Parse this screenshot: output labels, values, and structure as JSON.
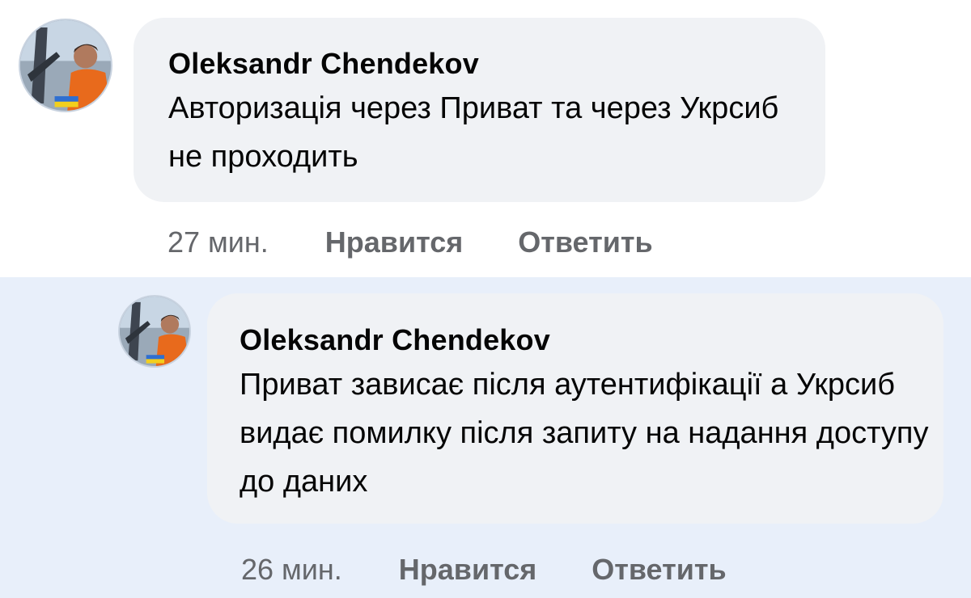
{
  "comments": [
    {
      "author": "Oleksandr Chendekov",
      "text": "Авторизація через Приват та через Укрсиб не проходить",
      "time": "27 мин.",
      "like_label": "Нравится",
      "reply_label": "Ответить"
    },
    {
      "author": "Oleksandr Chendekov",
      "text": "Приват зависає після аутентифікації а Укрсиб видає помилку після запиту на надання доступу до даних",
      "time": "26 мин.",
      "like_label": "Нравится",
      "reply_label": "Ответить"
    }
  ],
  "colors": {
    "bubble_bg": "#f0f2f5",
    "highlight_bg": "#e8effa",
    "text_primary": "#050505",
    "text_secondary": "#65676b"
  }
}
